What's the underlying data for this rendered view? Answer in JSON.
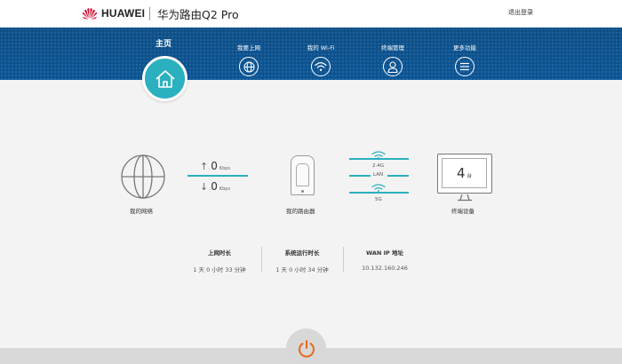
{
  "header": {
    "brand": "HUAWEI",
    "product_title": "华为路由Q2 Pro",
    "logout_label": "退出登录",
    "brand_color": "#cf0a2c"
  },
  "nav": {
    "home_label": "主页",
    "items": [
      {
        "label": "我要上网",
        "icon": "globe-icon"
      },
      {
        "label": "我的 Wi-Fi",
        "icon": "wifi-icon"
      },
      {
        "label": "终端管理",
        "icon": "user-icon"
      },
      {
        "label": "更多功能",
        "icon": "menu-icon"
      }
    ],
    "accent_color": "#2ab0bf",
    "band_color": "#0e4f87"
  },
  "status": {
    "network_label": "我的网络",
    "router_label": "我的路由器",
    "devices_label": "终端设备",
    "upload": {
      "value": "0",
      "unit": "Kbps"
    },
    "download": {
      "value": "0",
      "unit": "Kbps"
    },
    "band_24": "2.4G",
    "band_lan": "LAN",
    "band_5": "5G",
    "device_count": "4",
    "device_unit": "台"
  },
  "stats": [
    {
      "label": "上网时长",
      "value": "1 天 0 小时 33 分钟"
    },
    {
      "label": "系统运行时长",
      "value": "1 天 0 小时 34 分钟"
    },
    {
      "label": "WAN IP 地址",
      "value": "10.132.160.246"
    }
  ],
  "power": {
    "icon": "power-icon",
    "color": "#e86a1c"
  }
}
